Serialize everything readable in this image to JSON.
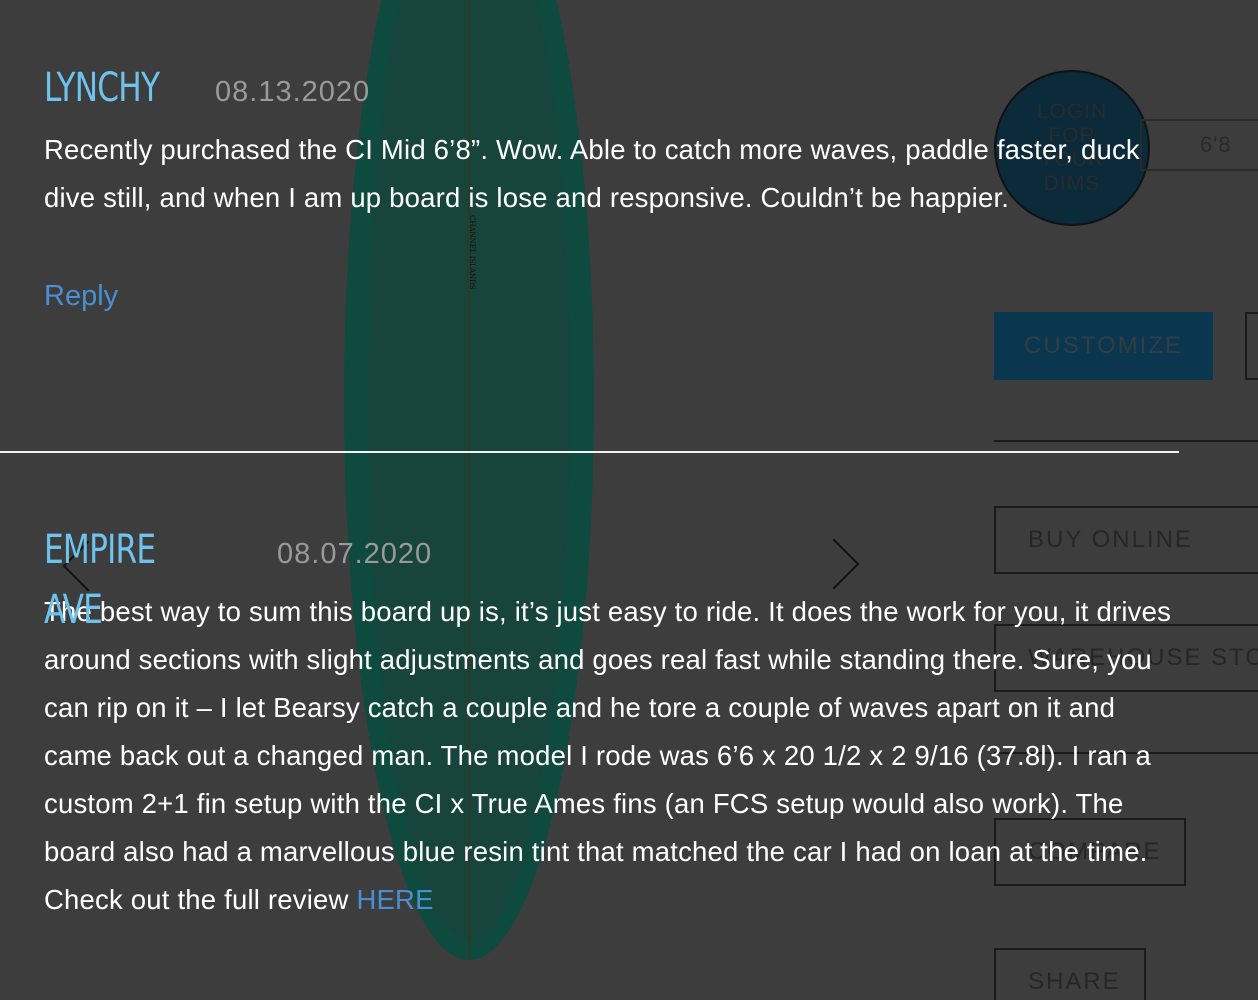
{
  "product_panel": {
    "board_logo": "CHANNEL ISLANDS",
    "login_dims_label": "LOGIN FOR YOUR DIMS",
    "size_value": "6'8",
    "customize_label": "CUSTOMIZE",
    "buy_online_label": "BUY ONLINE",
    "warehouse_stock_label": "WAREHOUSE STOCK",
    "compare_label": "COMPARE",
    "share_label": "SHARE"
  },
  "reviews": [
    {
      "name": "LYNCHY",
      "date": "08.13.2020",
      "body": "Recently purchased the CI Mid 6’8”. Wow. Able to catch more waves, paddle faster, duck dive still, and when I am up board is lose and responsive. Couldn’t be happier.",
      "reply_label": "Reply"
    },
    {
      "name": "EMPIRE AVE",
      "date": "08.07.2020",
      "body": "The best way to sum this board up is, it’s just easy to ride. It does the work for you, it drives around sections with slight adjustments and goes real fast while standing there. Sure, you can rip on it – I let Bearsy catch a couple and he tore a couple of waves apart on it and came back out a changed man. The model I rode was 6’6 x 20 1/2 x 2 9/16 (37.8l). I ran a custom 2+1 fin setup with the CI x True Ames fins (an FCS setup would also work). The board also had a marvellous blue resin tint that matched the car I had on loan at the time. Check out the full review ",
      "link_label": "HERE"
    }
  ],
  "colors": {
    "overlay_bg": "#3d3d3d",
    "name_blue": "#6dc3ee",
    "link_blue": "#4a8fd3",
    "date_gray": "#9a9a9a",
    "body_text": "#ffffff"
  }
}
